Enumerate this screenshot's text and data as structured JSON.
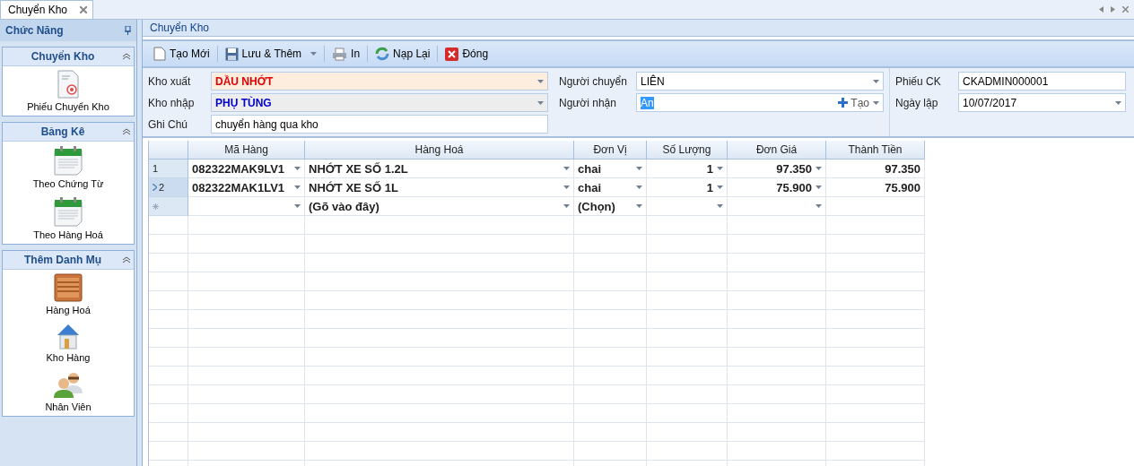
{
  "document_tabs": [
    {
      "label": "Chuyển Kho",
      "selected": true
    }
  ],
  "sidebar": {
    "title": "Chức Năng",
    "groups": [
      {
        "title": "Chuyển Kho",
        "expanded": true,
        "items": [
          {
            "label": "Phiếu Chuyển Kho",
            "kind": "document"
          }
        ]
      },
      {
        "title": "Bảng Kê",
        "expanded": true,
        "items": [
          {
            "label": "Theo Chứng Từ",
            "kind": "calendar"
          },
          {
            "label": "Theo Hàng Hoá",
            "kind": "calendar"
          }
        ]
      },
      {
        "title": "Thêm Danh Mụ",
        "expanded": true,
        "items": [
          {
            "label": "Hàng Hoá",
            "kind": "crate"
          },
          {
            "label": "Kho Hàng",
            "kind": "house"
          },
          {
            "label": "Nhân Viên",
            "kind": "people"
          }
        ]
      }
    ]
  },
  "panel": {
    "title": "Chuyển Kho"
  },
  "toolbar": [
    {
      "label": "Tạo Mới",
      "kind": "new",
      "menu": false
    },
    {
      "label": "Lưu & Thêm",
      "kind": "save",
      "menu": true
    },
    {
      "label": "In",
      "kind": "print",
      "menu": false
    },
    {
      "label": "Nạp Lại",
      "kind": "reload",
      "menu": false
    },
    {
      "label": "Đóng",
      "kind": "close",
      "menu": false
    }
  ],
  "form": {
    "left": [
      {
        "label": "Kho xuất",
        "value": "DẦU NHỚT",
        "kind": "combo",
        "color": "#e00000"
      },
      {
        "label": "Kho nhập",
        "value": "PHỤ TÙNG",
        "kind": "combo",
        "color": "#0000d0"
      },
      {
        "label": "Ghi Chú",
        "value": "chuyển hàng qua kho",
        "kind": "text"
      }
    ],
    "middle": [
      {
        "label": "Người chuyển",
        "value": "LIÊN",
        "kind": "combo",
        "text_selected": false
      },
      {
        "label": "Người nhận",
        "value": "An",
        "kind": "combo",
        "text_selected": true,
        "add_label": "Tạo"
      }
    ],
    "right": [
      {
        "label": "Phiếu CK",
        "value": "CKADMIN000001",
        "kind": "text"
      },
      {
        "label": "Ngày lập",
        "value": "10/07/2017",
        "kind": "combo"
      }
    ]
  },
  "grid": {
    "columns": [
      "Mã Hàng",
      "Hàng Hoá",
      "Đơn Vị",
      "Số Lượng",
      "Đơn Giá",
      "Thành Tiền"
    ],
    "rows": [
      {
        "kind": "data",
        "number": "1",
        "selected": false,
        "cells": [
          {
            "text": "082322MAK9LV1",
            "dropdown": true
          },
          {
            "text": "NHỚT XE SỐ 1.2L",
            "dropdown": true
          },
          {
            "text": "chai",
            "dropdown": true
          },
          {
            "text": "1",
            "dropdown": true
          },
          {
            "text": "97.350",
            "dropdown": true
          },
          {
            "text": "97.350",
            "dropdown": false
          }
        ]
      },
      {
        "kind": "data",
        "number": "2",
        "selected": true,
        "cells": [
          {
            "text": "082322MAK1LV1",
            "dropdown": true
          },
          {
            "text": "NHỚT XE SỐ 1L",
            "dropdown": true
          },
          {
            "text": "chai",
            "dropdown": true
          },
          {
            "text": "1",
            "dropdown": true
          },
          {
            "text": "75.900",
            "dropdown": true
          },
          {
            "text": "75.900",
            "dropdown": false
          }
        ]
      },
      {
        "kind": "new",
        "selected": false,
        "cells": [
          {
            "text": "",
            "dropdown": true
          },
          {
            "text": "(Gõ vào đây)",
            "dropdown": true
          },
          {
            "text": "(Chọn)",
            "dropdown": true
          },
          {
            "text": "",
            "dropdown": true
          },
          {
            "text": "",
            "dropdown": true
          },
          {
            "text": "",
            "dropdown": false
          }
        ]
      }
    ]
  }
}
